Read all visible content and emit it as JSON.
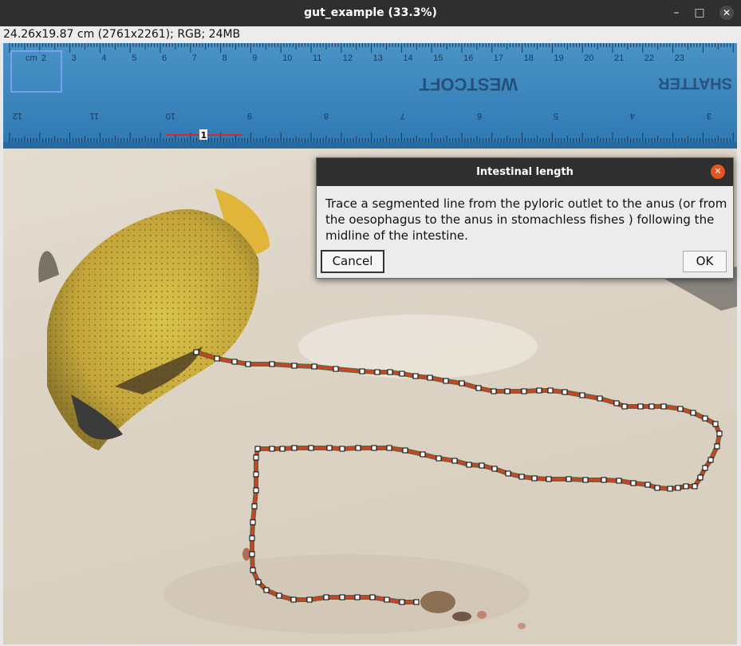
{
  "window": {
    "title": "gut_example (33.3%)"
  },
  "info_bar": {
    "text": "24.26x19.87 cm (2761x2261); RGB; 24MB"
  },
  "image": {
    "ruler": {
      "top_numbers": [
        "cm",
        "2",
        "3",
        "4",
        "5",
        "6",
        "7",
        "8",
        "9",
        "10",
        "11",
        "12",
        "13",
        "14",
        "15",
        "16",
        "17",
        "18",
        "19",
        "20",
        "21",
        "22",
        "23"
      ],
      "brand_text": "WESTCOFT",
      "brand_text_right": "SHATTER",
      "bottom_numbers": [
        "12",
        "11",
        "10",
        "9",
        "8",
        "7",
        "6",
        "5",
        "4",
        "3",
        "2"
      ]
    },
    "scale_marker_label": "1"
  },
  "dialog": {
    "title": "Intestinal length",
    "message": "Trace a segmented line from the pyloric outlet to the anus (or from the oesophagus to the anus in stomachless fishes ) following the midline of the intestine.",
    "cancel_label": "Cancel",
    "ok_label": "OK"
  }
}
